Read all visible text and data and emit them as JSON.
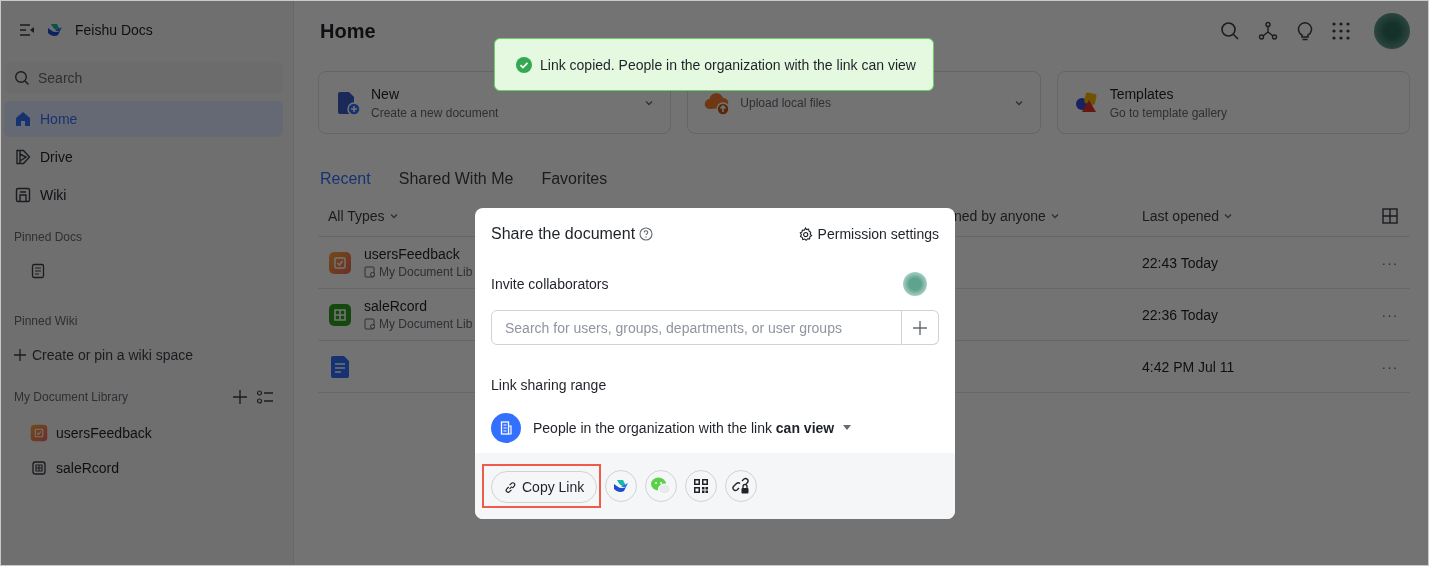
{
  "sidebar": {
    "app_name": "Feishu Docs",
    "search": {
      "placeholder": "Search"
    },
    "nav": [
      {
        "label": "Home",
        "kind": "home",
        "selected": true
      },
      {
        "label": "Drive",
        "kind": "drive",
        "selected": false
      },
      {
        "label": "Wiki",
        "kind": "wiki",
        "selected": false
      }
    ],
    "pinned_docs": {
      "title": "Pinned Docs",
      "items": [
        {
          "kind": "doc"
        }
      ]
    },
    "pinned_wiki": {
      "title": "Pinned Wiki",
      "action": "Create or pin a wiki space"
    },
    "library": {
      "title": "My Document Library",
      "items": [
        {
          "name": "usersFeedback",
          "kind": "form"
        },
        {
          "name": "saleRcord",
          "kind": "sheet"
        }
      ]
    }
  },
  "main": {
    "title": "Home",
    "cards": [
      {
        "kind": "new",
        "title": "New",
        "subtitle": "Create a new document",
        "has_menu": true
      },
      {
        "kind": "upload",
        "subtitle": "Upload local files",
        "has_menu": true
      },
      {
        "kind": "templates",
        "title": "Templates",
        "subtitle": "Go to template gallery",
        "has_menu": false
      }
    ],
    "tabs": [
      {
        "label": "Recent",
        "selected": true
      },
      {
        "label": "Shared With Me",
        "selected": false
      },
      {
        "label": "Favorites",
        "selected": false
      }
    ],
    "table": {
      "columns": [
        "All Types",
        "ned by anyone",
        "Last opened"
      ],
      "rows": [
        {
          "kind": "form",
          "name": "usersFeedback",
          "location": "My Document Lib",
          "opened": "22:43 Today",
          "more": "···"
        },
        {
          "kind": "sheet",
          "name": "saleRcord",
          "location": "My Document Lib",
          "opened": "22:36 Today",
          "more": "···"
        },
        {
          "kind": "doc",
          "opened": "4:42 PM Jul 11",
          "more": "···"
        }
      ]
    }
  },
  "toast": {
    "kind": "success",
    "text": "Link copied. People in the organization with the link can view"
  },
  "dialog": {
    "title": "Share the document",
    "permission": "Permission settings",
    "invite_label": "Invite collaborators",
    "search": {
      "placeholder": "Search for users, groups, departments, or user groups"
    },
    "range_label": "Link sharing range",
    "range_text": "People in the organization with the link **can view**",
    "copy": {
      "label": "Copy Link",
      "highlighted": true
    },
    "share_targets": [
      {
        "kind": "feishu"
      },
      {
        "kind": "wechat"
      },
      {
        "kind": "qr"
      },
      {
        "kind": "lock-link"
      }
    ]
  }
}
